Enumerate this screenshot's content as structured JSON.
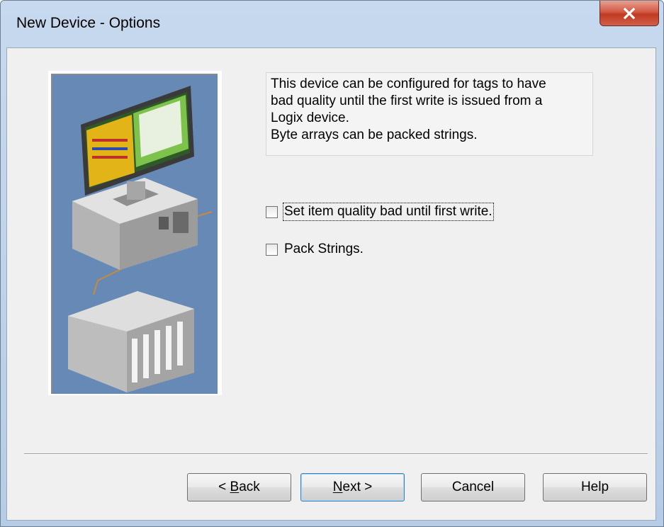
{
  "window": {
    "title": "New Device - Options",
    "close_symbol": "X"
  },
  "description": {
    "lines": [
      "This device can be configured for tags to have",
      "bad quality until the first write is issued from a",
      "Logix device.",
      "Byte arrays can be packed strings."
    ]
  },
  "options": [
    {
      "label": "Set item quality bad until first write.",
      "checked": false
    },
    {
      "label": "Pack Strings.",
      "checked": false
    }
  ],
  "buttons": {
    "back": {
      "prefix": "< ",
      "mnemonic": "B",
      "rest": "ack"
    },
    "next": {
      "mnemonic": "N",
      "rest": "ext >"
    },
    "cancel": "Cancel",
    "help": "Help"
  },
  "icons": {
    "close": "close-icon",
    "illustration": "device-network-illustration"
  },
  "colors": {
    "illustration_bg": "#6789b5",
    "close_button": "#c8452e"
  }
}
